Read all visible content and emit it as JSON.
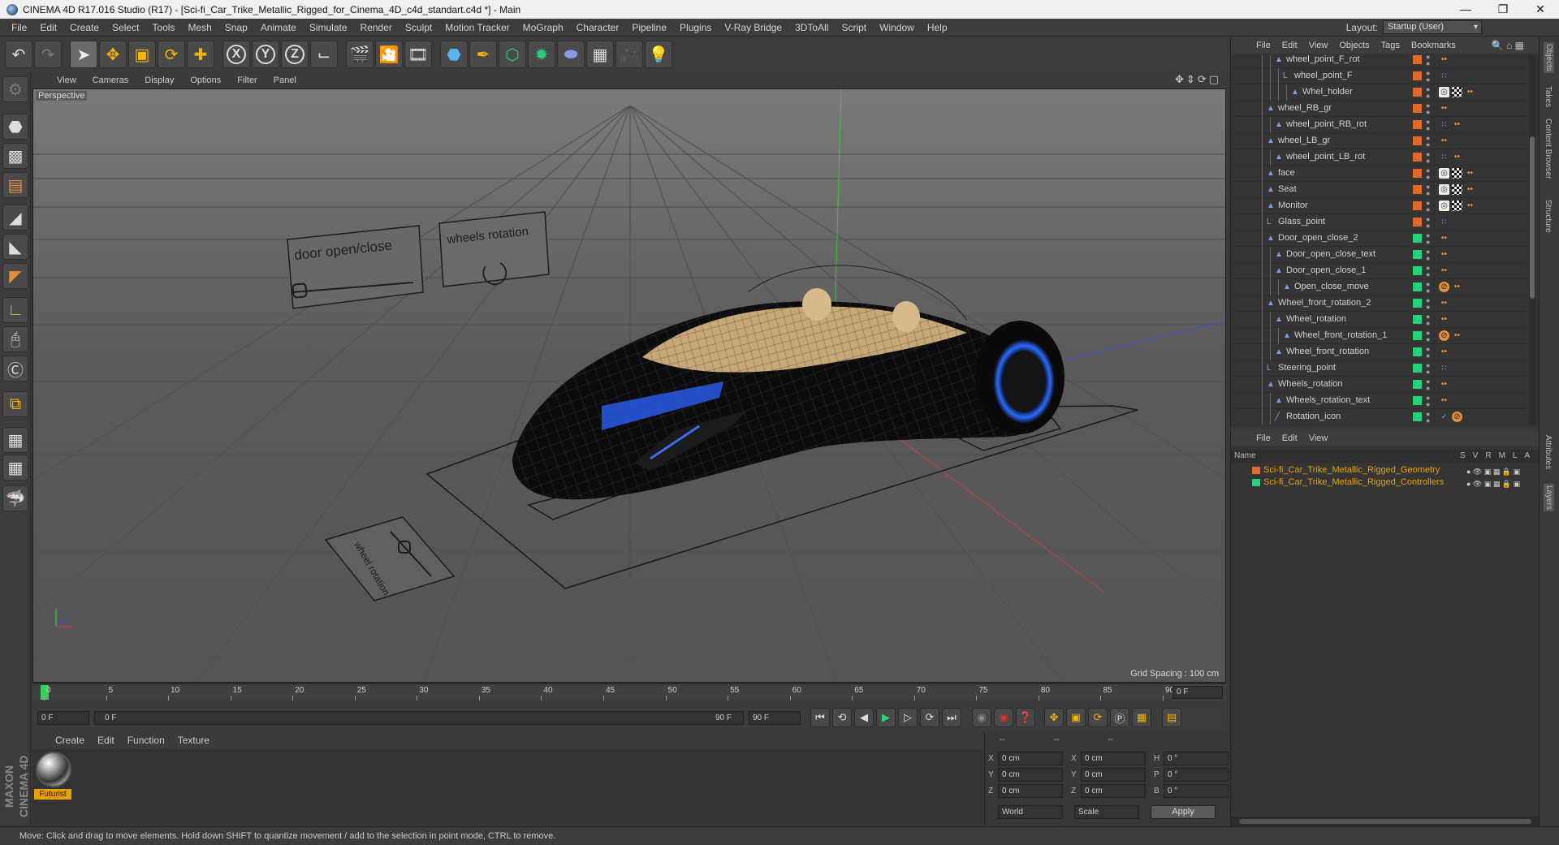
{
  "window": {
    "title": "CINEMA 4D R17.016 Studio (R17) - [Sci-fi_Car_Trike_Metallic_Rigged_for_Cinema_4D_c4d_standart.c4d *] - Main"
  },
  "menubar": {
    "items": [
      "File",
      "Edit",
      "Create",
      "Select",
      "Tools",
      "Mesh",
      "Snap",
      "Animate",
      "Simulate",
      "Render",
      "Sculpt",
      "Motion Tracker",
      "MoGraph",
      "Character",
      "Pipeline",
      "Plugins",
      "V-Ray Bridge",
      "3DToAll",
      "Script",
      "Window",
      "Help"
    ],
    "layout_label": "Layout:",
    "layout_value": "Startup (User)"
  },
  "viewport": {
    "menu": [
      "View",
      "Cameras",
      "Display",
      "Options",
      "Filter",
      "Panel"
    ],
    "label": "Perspective",
    "grid_spacing": "Grid Spacing : 100 cm",
    "controller_door": "door open/close",
    "controller_wheels": "wheels rotation",
    "controller_wheel_rot": "wheel rotation"
  },
  "timeline": {
    "ticks": [
      "0",
      "5",
      "10",
      "15",
      "20",
      "25",
      "30",
      "35",
      "40",
      "45",
      "50",
      "55",
      "60",
      "65",
      "70",
      "75",
      "80",
      "85",
      "90"
    ],
    "current_frame": "0 F",
    "start_field": "0 F",
    "slider_start": "0 F",
    "slider_end": "90 F",
    "end_field": "90 F"
  },
  "material": {
    "menu": [
      "Create",
      "Edit",
      "Function",
      "Texture"
    ],
    "name": "Futurist"
  },
  "coords": {
    "headers": [
      "--",
      "--",
      "--"
    ],
    "rows": [
      {
        "a": "X",
        "av": "0 cm",
        "b": "X",
        "bv": "0 cm",
        "c": "H",
        "cv": "0 °"
      },
      {
        "a": "Y",
        "av": "0 cm",
        "b": "Y",
        "bv": "0 cm",
        "c": "P",
        "cv": "0 °"
      },
      {
        "a": "Z",
        "av": "0 cm",
        "b": "Z",
        "bv": "0 cm",
        "c": "B",
        "cv": "0 °"
      }
    ],
    "mode": "World",
    "type": "Scale",
    "apply": "Apply"
  },
  "status": {
    "text": "Move: Click and drag to move elements. Hold down SHIFT to quantize movement / add to the selection in point mode, CTRL to remove."
  },
  "objects": {
    "menu": [
      "File",
      "Edit",
      "View",
      "Objects",
      "Tags",
      "Bookmarks"
    ],
    "rows": [
      {
        "name": "wheel_point_F_rot",
        "indent": 2,
        "icon": "null",
        "layer": "#e06a2a",
        "tags": [
          "null"
        ]
      },
      {
        "name": "wheel_point_F",
        "indent": 3,
        "icon": "L0",
        "layer": "#e06a2a",
        "tags": [
          "xp"
        ]
      },
      {
        "name": "Whel_holder",
        "indent": 4,
        "icon": "null",
        "layer": "#e06a2a",
        "tags": [
          "tex",
          "chk",
          "null"
        ]
      },
      {
        "name": "wheel_RB_gr",
        "indent": 1,
        "icon": "null",
        "layer": "#e06a2a",
        "tags": [
          "null"
        ]
      },
      {
        "name": "wheel_point_RB_rot",
        "indent": 2,
        "icon": "null",
        "layer": "#e06a2a",
        "tags": [
          "xp",
          "null"
        ]
      },
      {
        "name": "wheel_LB_gr",
        "indent": 1,
        "icon": "null",
        "layer": "#e06a2a",
        "tags": [
          "null"
        ]
      },
      {
        "name": "wheel_point_LB_rot",
        "indent": 2,
        "icon": "null",
        "layer": "#e06a2a",
        "tags": [
          "xp",
          "null"
        ]
      },
      {
        "name": "face",
        "indent": 1,
        "icon": "null",
        "layer": "#e06a2a",
        "tags": [
          "tex",
          "chk",
          "null"
        ]
      },
      {
        "name": "Seat",
        "indent": 1,
        "icon": "null",
        "layer": "#e06a2a",
        "tags": [
          "tex",
          "chk",
          "null"
        ]
      },
      {
        "name": "Monitor",
        "indent": 1,
        "icon": "null",
        "layer": "#e06a2a",
        "tags": [
          "tex",
          "chk",
          "null"
        ]
      },
      {
        "name": "Glass_point",
        "indent": 1,
        "icon": "L0",
        "layer": "#e06a2a",
        "tags": [
          "xp"
        ]
      },
      {
        "name": "Door_open_close_2",
        "indent": 1,
        "icon": "null",
        "layer": "#27d37a",
        "tags": [
          "null"
        ]
      },
      {
        "name": "Door_open_close_text",
        "indent": 2,
        "icon": "null",
        "layer": "#27d37a",
        "tags": [
          "null"
        ]
      },
      {
        "name": "Door_open_close_1",
        "indent": 2,
        "icon": "null",
        "layer": "#27d37a",
        "tags": [
          "null"
        ]
      },
      {
        "name": "Open_close_move",
        "indent": 3,
        "icon": "null",
        "layer": "#27d37a",
        "tags": [
          "stop",
          "null"
        ]
      },
      {
        "name": "Wheel_front_rotation_2",
        "indent": 1,
        "icon": "null",
        "layer": "#27d37a",
        "tags": [
          "null"
        ]
      },
      {
        "name": "Wheel_rotation",
        "indent": 2,
        "icon": "null",
        "layer": "#27d37a",
        "tags": [
          "null"
        ]
      },
      {
        "name": "Wheel_front_rotation_1",
        "indent": 3,
        "icon": "null",
        "layer": "#27d37a",
        "tags": [
          "stop",
          "null"
        ]
      },
      {
        "name": "Wheel_front_rotation",
        "indent": 2,
        "icon": "null",
        "layer": "#27d37a",
        "tags": [
          "null"
        ]
      },
      {
        "name": "Steering_point",
        "indent": 1,
        "icon": "L0",
        "layer": "#27d37a",
        "tags": [
          "xp"
        ]
      },
      {
        "name": "Wheels_rotation",
        "indent": 1,
        "icon": "null",
        "layer": "#27d37a",
        "tags": [
          "null"
        ]
      },
      {
        "name": "Wheels_rotation_text",
        "indent": 2,
        "icon": "null",
        "layer": "#27d37a",
        "tags": [
          "null"
        ]
      },
      {
        "name": "Rotation_icon",
        "indent": 2,
        "icon": "spline",
        "layer": "#27d37a",
        "tags": [
          "check",
          "stop"
        ]
      }
    ]
  },
  "layers": {
    "menu": [
      "File",
      "Edit",
      "View"
    ],
    "header_name": "Name",
    "columns": [
      "S",
      "V",
      "R",
      "M",
      "L",
      "A"
    ],
    "rows": [
      {
        "name": "Sci-fi_Car_Trike_Metallic_Rigged_Geometry",
        "color": "#e06a2a"
      },
      {
        "name": "Sci-fi_Car_Trike_Metallic_Rigged_Controllers",
        "color": "#27d37a"
      }
    ]
  },
  "right_tabs": [
    "Objects",
    "Takes",
    "Content Browser",
    "Structure",
    "Attributes",
    "Layers"
  ]
}
